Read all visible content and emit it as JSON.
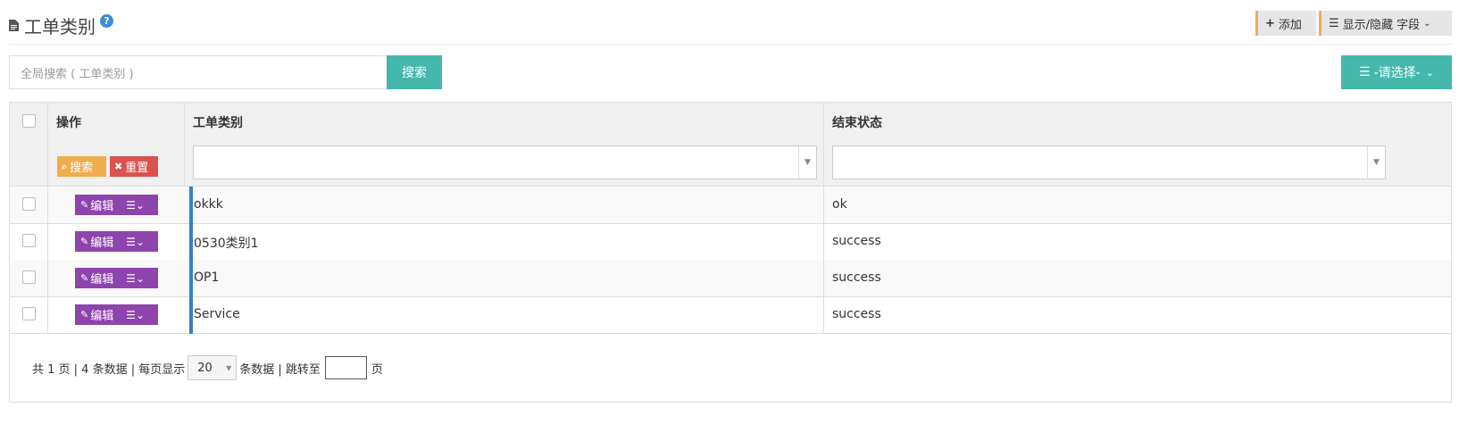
{
  "header": {
    "title": "工单类别",
    "help_glyph": "?",
    "add_label": "添加",
    "columns_label": "显示/隐藏 字段"
  },
  "search": {
    "placeholder": "全局搜索 ( 工单类别 )",
    "button_label": "搜索",
    "select_label": "-请选择-"
  },
  "table": {
    "columns": [
      "操作",
      "工单类别",
      "结束状态"
    ],
    "filter_search_label": "搜索",
    "filter_reset_label": "重置",
    "edit_label": "编辑",
    "rows": [
      {
        "category": "okkk",
        "end_status": "ok"
      },
      {
        "category": "0530类别1",
        "end_status": "success"
      },
      {
        "category": "OP1",
        "end_status": "success"
      },
      {
        "category": "Service",
        "end_status": "success"
      }
    ]
  },
  "pagination": {
    "summary": "共 1 页 | 4 条数据 | 每页显示",
    "page_size": "20",
    "after_size": "条数据 | 跳转至",
    "page_suffix": "页"
  },
  "colors": {
    "teal": "#45b8ac",
    "orange": "#f0ad4e",
    "red": "#d9534f",
    "purple": "#8e44ad",
    "accent_blue": "#3a7ec2"
  }
}
